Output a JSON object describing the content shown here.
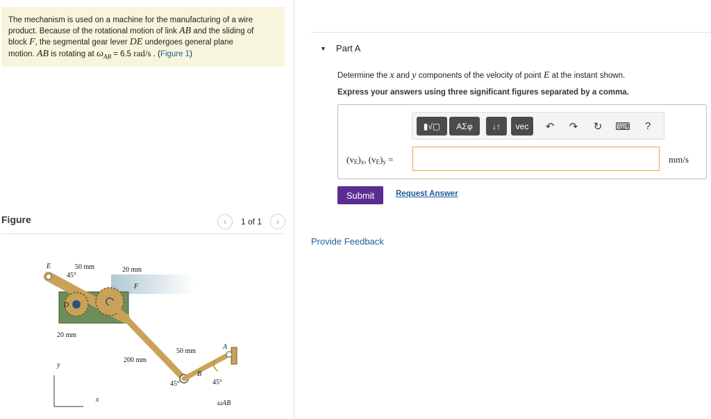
{
  "problem": {
    "line1": "The mechanism is used on a machine for the manufacturing of a wire",
    "line2a": "product. Because of the rotational motion of link ",
    "var_AB": "AB",
    "line2b": " and the sliding of",
    "line3a": "block ",
    "var_F": "F",
    "line3b": ", the segmental gear lever ",
    "var_DE": "DE",
    "line3c": " undergoes general plane",
    "line4a": "motion. ",
    "var_AB2": "AB",
    "line4b": " is rotating at ",
    "omega_symbol": "ω",
    "omega_sub": "AB",
    "omega_value": " = 6.5 ",
    "omega_unit": "rad/s",
    "line4c": " . (",
    "figure_link": "Figure 1",
    "line4d": ")"
  },
  "figure": {
    "title": "Figure",
    "pager_text": "1 of 1",
    "prev_icon": "‹",
    "next_icon": "›",
    "labels": {
      "E": "E",
      "dim_50mm_top": "50 mm",
      "angle_45_top": "45°",
      "dim_20mm_top": "20 mm",
      "F": "F",
      "D": "D",
      "dim_20mm_left": "20 mm",
      "dim_200mm": "200 mm",
      "dim_50mm_right": "50 mm",
      "A": "A",
      "B": "B",
      "angle_45_left": "45°",
      "angle_45_right": "45°",
      "y_axis": "y",
      "x_axis": "x",
      "omega_label": "ωAB"
    }
  },
  "part": {
    "title": "Part A",
    "question_a": "Determine the ",
    "var_x": "x",
    "question_b": " and ",
    "var_y": "y",
    "question_c": " components of the velocity of point ",
    "var_E": "E",
    "question_d": " at the instant shown.",
    "instruction": "Express your answers using three significant figures separated by a comma."
  },
  "toolbar": {
    "templates": "▮√▢",
    "greek": "ΑΣφ",
    "arrows": "↓↑",
    "vec": "vec",
    "undo": "↶",
    "redo": "↷",
    "reset": "↻",
    "keyboard": "⌨",
    "help": "?"
  },
  "answer": {
    "label_a": "(v",
    "label_sub1": "E",
    "label_b": ")",
    "label_sub2": "x",
    "label_c": ", (v",
    "label_sub3": "E",
    "label_d": ")",
    "label_sub4": "y",
    "label_e": " =",
    "value": "",
    "unit": "mm/s"
  },
  "actions": {
    "submit": "Submit",
    "request": "Request Answer",
    "feedback": "Provide Feedback"
  },
  "colors": {
    "problem_bg": "#f7f5dc",
    "link": "#1d5d9b",
    "submit_bg": "#5b2d91",
    "input_border": "#e0a84a",
    "gear_block": "#6b8e5a",
    "link_bar": "#c9a25a"
  }
}
